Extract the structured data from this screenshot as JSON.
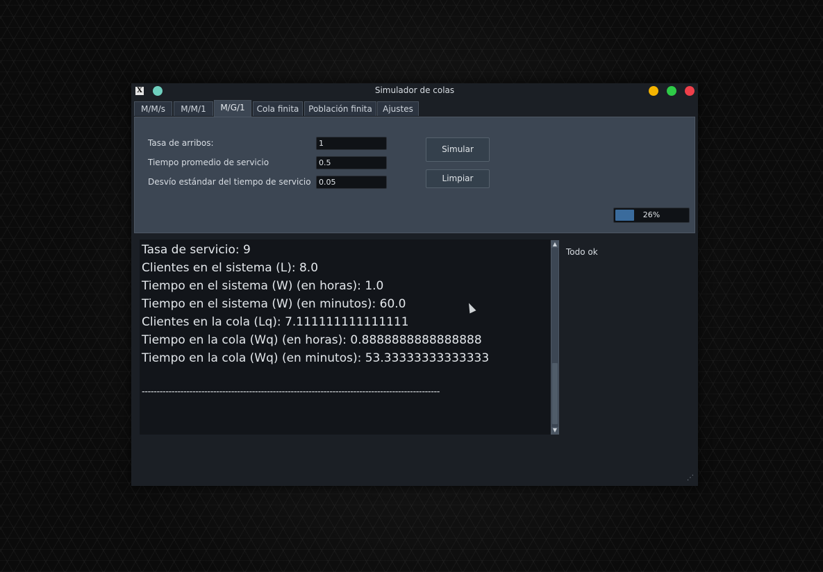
{
  "window": {
    "title": "Simulador de colas"
  },
  "tabs": [
    "M/M/s",
    "M/M/1",
    "M/G/1",
    "Cola finita",
    "Población finita",
    "Ajustes"
  ],
  "form": {
    "arrival_rate_label": "Tasa de arribos:",
    "arrival_rate_value": "1",
    "service_time_label": "Tiempo promedio de servicio",
    "service_time_value": "0.5",
    "service_std_label": "Desvío estándar del tiempo de servicio",
    "service_std_value": "0.05",
    "simulate_label": "Simular",
    "clear_label": "Limpiar"
  },
  "progress": {
    "text": "26%",
    "fraction": 0.26
  },
  "output": {
    "lines": [
      "Tasa de servicio: 9",
      "Clientes en el sistema (L): 8.0",
      "Tiempo en el sistema (W) (en horas): 1.0",
      "Tiempo en el sistema (W) (en minutos): 60.0",
      "Clientes en la cola (Lq): 7.111111111111111",
      "Tiempo en la cola (Wq) (en horas): 0.8888888888888888",
      "Tiempo en la cola (Wq) (en minutos): 53.33333333333333"
    ],
    "separator": "----------------------------------------------------------------------------------------------------"
  },
  "status": "Todo ok"
}
